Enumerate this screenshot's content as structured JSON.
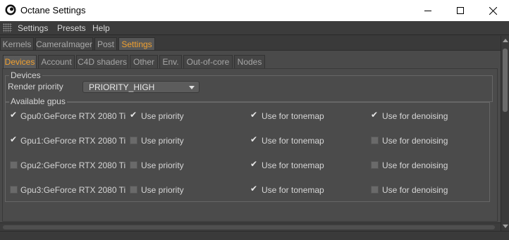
{
  "window": {
    "title": "Octane Settings",
    "icons": [
      "app-icon",
      "minimize-icon",
      "maximize-icon",
      "close-icon"
    ]
  },
  "menu": {
    "items": [
      {
        "label": "Settings"
      },
      {
        "label": "Presets"
      },
      {
        "label": "Help"
      }
    ]
  },
  "top_tabs": [
    {
      "label": "Kernels",
      "active": false
    },
    {
      "label": "CameraImager",
      "active": false
    },
    {
      "label": "Post",
      "active": false
    },
    {
      "label": "Settings",
      "active": true
    }
  ],
  "sub_tabs": [
    {
      "label": "Devices",
      "active": true
    },
    {
      "label": "Account",
      "active": false
    },
    {
      "label": "C4D shaders",
      "active": false
    },
    {
      "label": "Other",
      "active": false
    },
    {
      "label": "Env.",
      "active": false
    },
    {
      "label": "Out-of-core",
      "active": false
    },
    {
      "label": "Nodes",
      "active": false
    }
  ],
  "devices": {
    "group_title": "Devices",
    "render_priority_label": "Render priority",
    "render_priority_value": "PRIORITY_HIGH"
  },
  "gpus": {
    "group_title": "Available gpus",
    "rows": [
      {
        "name": "Gpu0:GeForce RTX 2080 Ti",
        "enabled": true,
        "priority_label": "Use priority",
        "priority": true,
        "tonemap_label": "Use for tonemap",
        "tonemap": true,
        "denoise_label": "Use for denoising",
        "denoise": true
      },
      {
        "name": "Gpu1:GeForce RTX 2080 Ti",
        "enabled": true,
        "priority_label": "Use priority",
        "priority": false,
        "tonemap_label": "Use for tonemap",
        "tonemap": true,
        "denoise_label": "Use for denoising",
        "denoise": false
      },
      {
        "name": "Gpu2:GeForce RTX 2080 Ti",
        "enabled": false,
        "priority_label": "Use priority",
        "priority": false,
        "tonemap_label": "Use for tonemap",
        "tonemap": true,
        "denoise_label": "Use for denoising",
        "denoise": false
      },
      {
        "name": "Gpu3:GeForce RTX 2080 Ti",
        "enabled": false,
        "priority_label": "Use priority",
        "priority": false,
        "tonemap_label": "Use for tonemap",
        "tonemap": true,
        "denoise_label": "Use for denoising",
        "denoise": false
      }
    ]
  },
  "colors": {
    "accent": "#f0a030",
    "panel": "#4a4a4a",
    "text": "#d6d6d6"
  }
}
